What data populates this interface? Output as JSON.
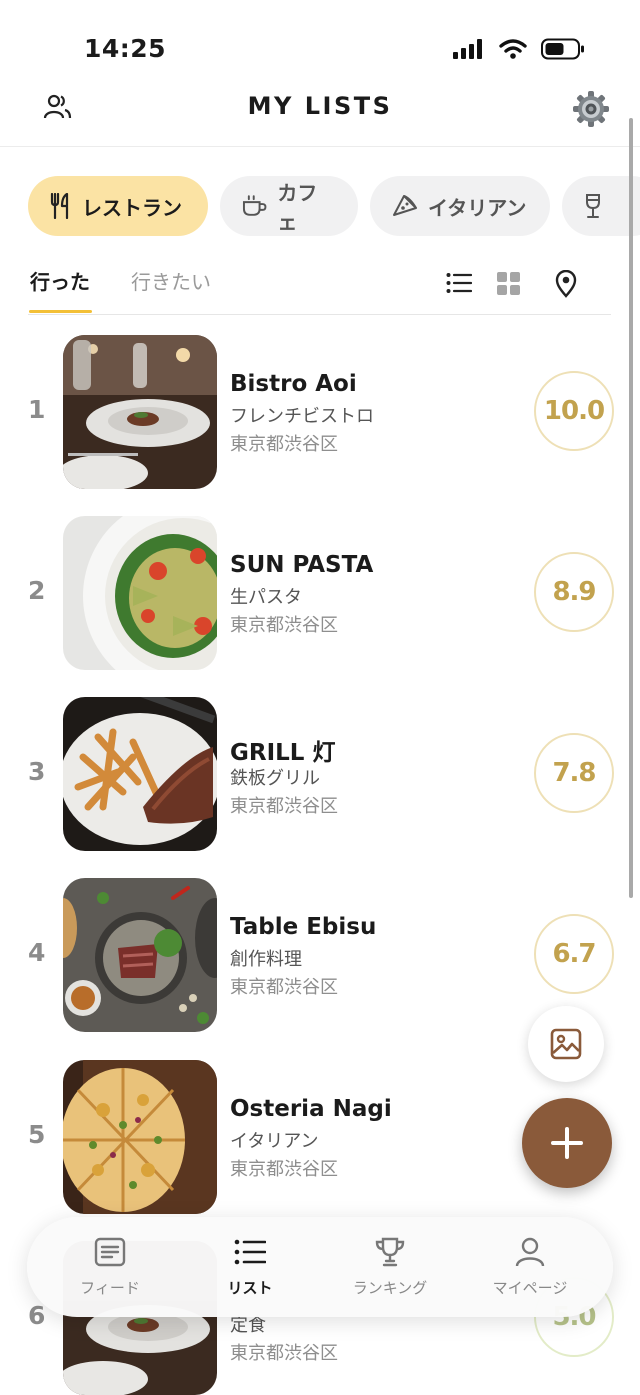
{
  "status_bar": {
    "time": "14:25"
  },
  "header": {
    "title": "MY LISTS"
  },
  "categories": [
    {
      "label": "レストラン",
      "icon": "fork-knife-icon",
      "active": true
    },
    {
      "label": "カフェ",
      "icon": "coffee-cup-icon",
      "active": false
    },
    {
      "label": "イタリアン",
      "icon": "pizza-icon",
      "active": false
    },
    {
      "label": "",
      "icon": "wine-glass-icon",
      "active": false
    }
  ],
  "tabs": [
    {
      "label": "行った",
      "active": true
    },
    {
      "label": "行きたい",
      "active": false
    }
  ],
  "view_icons": [
    "list-view-icon",
    "grid-view-icon",
    "map-pin-icon"
  ],
  "restaurants": [
    {
      "rank": "1",
      "name": "Bistro Aoi",
      "genre": "フレンチビストロ",
      "area": "東京都渋谷区",
      "score": "10.0"
    },
    {
      "rank": "2",
      "name": "SUN PASTA",
      "genre": "生パスタ",
      "area": "東京都渋谷区",
      "score": "8.9"
    },
    {
      "rank": "3",
      "name": "GRILL 灯",
      "genre": "鉄板グリル",
      "area": "東京都渋谷区",
      "score": "7.8"
    },
    {
      "rank": "4",
      "name": "Table Ebisu",
      "genre": "創作料理",
      "area": "東京都渋谷区",
      "score": "6.7"
    },
    {
      "rank": "5",
      "name": "Osteria Nagi",
      "genre": "イタリアン",
      "area": "東京都渋谷区",
      "score": ""
    },
    {
      "rank": "6",
      "name": "",
      "genre": "定食",
      "area": "東京都渋谷区",
      "score": "5.0"
    }
  ],
  "bottom_nav": [
    {
      "label": "フィード",
      "icon": "feed-icon",
      "active": false
    },
    {
      "label": "リスト",
      "icon": "list-icon",
      "active": true
    },
    {
      "label": "ランキング",
      "icon": "trophy-icon",
      "active": false
    },
    {
      "label": "マイページ",
      "icon": "person-icon",
      "active": false
    }
  ],
  "colors": {
    "accent": "#f3c037",
    "chip_active": "#fbe3a4",
    "score_text": "#c2a24e",
    "fab": "#8a5a3a"
  }
}
